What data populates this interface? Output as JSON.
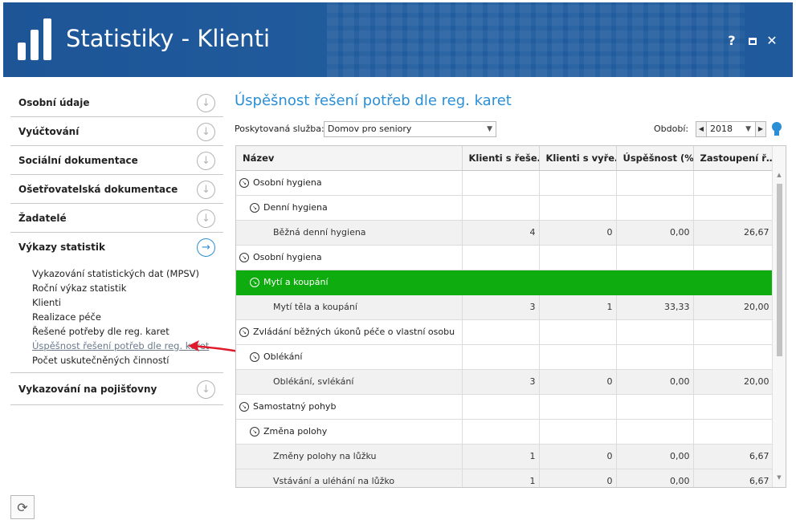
{
  "window": {
    "title": "Statistiky - Klienti",
    "buttons": {
      "help": "?",
      "maximize": "",
      "close": "✕"
    }
  },
  "sidebar": {
    "sections": [
      {
        "label": "Osobní údaje"
      },
      {
        "label": "Vyúčtování"
      },
      {
        "label": "Sociální dokumentace"
      },
      {
        "label": "Ošetřovatelská dokumentace"
      },
      {
        "label": "Žadatelé"
      },
      {
        "label": "Výkazy statistik"
      }
    ],
    "subitems": [
      "Vykazování statistických dat (MPSV)",
      "Roční výkaz statistik",
      "Klienti",
      "Realizace péče",
      "Řešené potřeby dle reg. karet",
      "Úspěšnost řešení potřeb dle reg. karet",
      "Počet uskutečněných činností"
    ],
    "last_section": "Vykazování na pojišťovny"
  },
  "main": {
    "title": "Úspěšnost řešení potřeb dle reg. karet",
    "service_label": "Poskytovaná služba:",
    "service_value": "Domov pro seniory",
    "period_label": "Období:",
    "period_value": "2018"
  },
  "table": {
    "columns": [
      "Název",
      "Klienti s řeše…",
      "Klienti s vyře…",
      "Úspěšnost (%)",
      "Zastoupení ř…"
    ],
    "rows": [
      {
        "level": 1,
        "name": "Osobní hygiena",
        "c1": "",
        "c2": "",
        "c3": "",
        "c4": ""
      },
      {
        "level": 2,
        "name": "Denní hygiena",
        "c1": "",
        "c2": "",
        "c3": "",
        "c4": ""
      },
      {
        "level": 3,
        "name": "Běžná denní hygiena",
        "c1": "4",
        "c2": "0",
        "c3": "0,00",
        "c4": "26,67"
      },
      {
        "level": 1,
        "name": "Osobní hygiena",
        "c1": "",
        "c2": "",
        "c3": "",
        "c4": ""
      },
      {
        "level": 2,
        "name": "Mytí a koupání",
        "c1": "",
        "c2": "",
        "c3": "",
        "c4": "",
        "selected": true
      },
      {
        "level": 3,
        "name": "Mytí těla a koupání",
        "c1": "3",
        "c2": "1",
        "c3": "33,33",
        "c4": "20,00"
      },
      {
        "level": 1,
        "name": "Zvládání běžných úkonů péče o vlastní osobu",
        "c1": "",
        "c2": "",
        "c3": "",
        "c4": ""
      },
      {
        "level": 2,
        "name": "Oblékání",
        "c1": "",
        "c2": "",
        "c3": "",
        "c4": ""
      },
      {
        "level": 3,
        "name": "Oblékání, svlékání",
        "c1": "3",
        "c2": "0",
        "c3": "0,00",
        "c4": "20,00"
      },
      {
        "level": 1,
        "name": "Samostatný pohyb",
        "c1": "",
        "c2": "",
        "c3": "",
        "c4": ""
      },
      {
        "level": 2,
        "name": "Změna polohy",
        "c1": "",
        "c2": "",
        "c3": "",
        "c4": ""
      },
      {
        "level": 3,
        "name": "Změny polohy na lůžku",
        "c1": "1",
        "c2": "0",
        "c3": "0,00",
        "c4": "6,67"
      },
      {
        "level": 3,
        "name": "Vstávání a uléhání na lůžko",
        "c1": "1",
        "c2": "0",
        "c3": "0,00",
        "c4": "6,67"
      }
    ]
  },
  "colors": {
    "header_blue": "#1f5a9c",
    "accent_blue": "#2b8fd6",
    "selected_row": "#0fac0f",
    "annotation_arrow": "#e0192a"
  }
}
